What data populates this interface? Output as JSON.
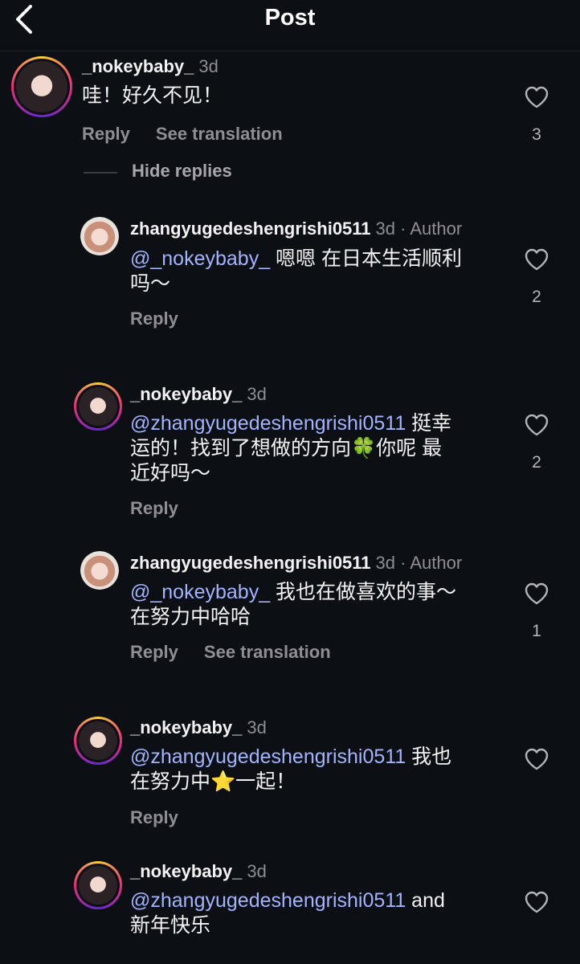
{
  "header": {
    "title": "Post"
  },
  "labels": {
    "reply": "Reply",
    "see_translation": "See translation",
    "hide_replies": "Hide replies",
    "author": "Author"
  },
  "comments": [
    {
      "username": "_nokeybaby_",
      "time": "3d",
      "text": "哇！好久不见！",
      "likes": "3"
    },
    {
      "username": "zhangyugedeshengrishi0511",
      "time": "3d",
      "mention": "@_nokeybaby_",
      "text_l1": " 嗯嗯 在日本生活顺利",
      "text_l2": "吗～",
      "likes": "2"
    },
    {
      "username": "_nokeybaby_",
      "time": "3d",
      "mention": "@zhangyugedeshengrishi0511",
      "text_l1": " 挺幸",
      "text_l2a": "运的！找到了想做的方向",
      "emoji": "🍀",
      "text_l2b": "你呢 最",
      "text_l3": "近好吗～",
      "likes": "2"
    },
    {
      "username": "zhangyugedeshengrishi0511",
      "time": "3d",
      "mention": "@_nokeybaby_",
      "text_l1": " 我也在做喜欢的事～",
      "text_l2": "在努力中哈哈",
      "likes": "1"
    },
    {
      "username": "_nokeybaby_",
      "time": "3d",
      "mention": "@zhangyugedeshengrishi0511",
      "text_l1": " 我也",
      "text_l2a": "在努力中",
      "emoji": "⭐",
      "text_l2b": "一起！"
    },
    {
      "username": "_nokeybaby_",
      "time": "3d",
      "mention": "@zhangyugedeshengrishi0511",
      "text_l1": " and",
      "text_l2": "新年快乐"
    }
  ]
}
